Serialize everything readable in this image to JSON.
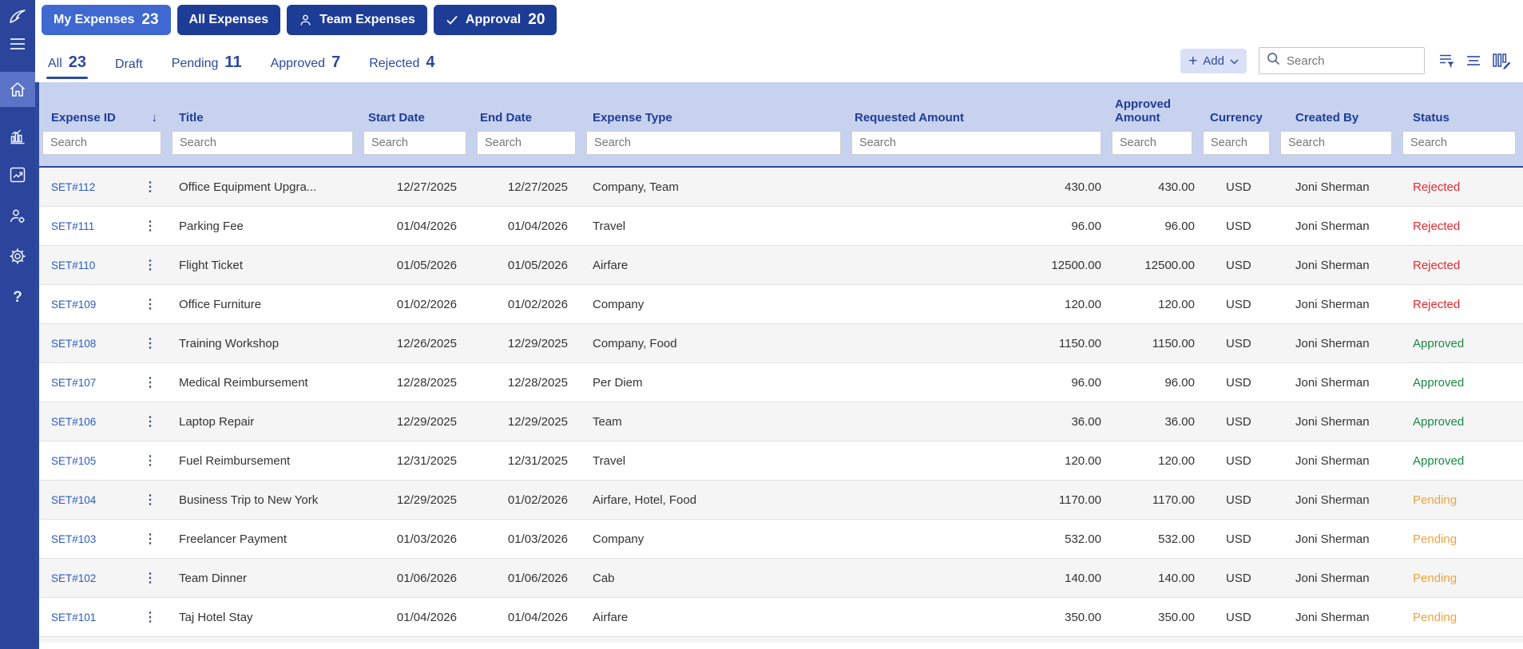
{
  "colors": {
    "sidebar": "#2a459b",
    "sidebar_active": "#5b74c7",
    "tab_active": "#3f69d1",
    "tab_inactive": "#1d3c96",
    "accent": "#2b4a9e",
    "header_bg": "#c7d2ef",
    "link": "#2a5cc0",
    "status": {
      "Rejected": "#e52b2f",
      "Approved": "#188a42",
      "Pending": "#f0a33c"
    }
  },
  "sidebar": {
    "icons": [
      "logo",
      "hamburger-menu",
      "home",
      "bar-chart",
      "trend-line",
      "user-settings",
      "gear",
      "help"
    ],
    "help_glyph": "?"
  },
  "top_tabs": [
    {
      "label": "My Expenses",
      "count": "23",
      "active": true,
      "icon": ""
    },
    {
      "label": "All Expenses",
      "count": "",
      "active": false,
      "icon": ""
    },
    {
      "label": "Team Expenses",
      "count": "",
      "active": false,
      "icon": "person"
    },
    {
      "label": "Approval",
      "count": "20",
      "active": false,
      "icon": "check"
    }
  ],
  "filter_tabs": [
    {
      "label": "All",
      "count": "23",
      "active": true
    },
    {
      "label": "Draft",
      "count": "",
      "active": false
    },
    {
      "label": "Pending",
      "count": "11",
      "active": false
    },
    {
      "label": "Approved",
      "count": "7",
      "active": false
    },
    {
      "label": "Rejected",
      "count": "4",
      "active": false
    }
  ],
  "toolbar": {
    "add_label": "Add",
    "add_plus": "+",
    "search_placeholder": "Search",
    "icons": [
      "filter-list",
      "group-lines",
      "edit-columns"
    ]
  },
  "table": {
    "search_placeholder": "Search",
    "sort_arrow": "↓",
    "row_menu_glyph": "⋮",
    "columns": [
      {
        "label": "Expense ID",
        "sorted": "desc"
      },
      {
        "label": "Title"
      },
      {
        "label": "Start Date"
      },
      {
        "label": "End Date"
      },
      {
        "label": "Expense Type"
      },
      {
        "label": "Requested Amount"
      },
      {
        "label": "Approved Amount"
      },
      {
        "label": "Currency"
      },
      {
        "label": "Created By"
      },
      {
        "label": "Status"
      }
    ],
    "rows": [
      {
        "id": "SET#112",
        "title": "Office Equipment Upgra...",
        "start": "12/27/2025",
        "end": "12/27/2025",
        "type": "Company, Team",
        "requested": "430.00",
        "approved": "430.00",
        "currency": "USD",
        "created_by": "Joni Sherman",
        "status": "Rejected"
      },
      {
        "id": "SET#111",
        "title": "Parking Fee",
        "start": "01/04/2026",
        "end": "01/04/2026",
        "type": "Travel",
        "requested": "96.00",
        "approved": "96.00",
        "currency": "USD",
        "created_by": "Joni Sherman",
        "status": "Rejected"
      },
      {
        "id": "SET#110",
        "title": "Flight Ticket",
        "start": "01/05/2026",
        "end": "01/05/2026",
        "type": "Airfare",
        "requested": "12500.00",
        "approved": "12500.00",
        "currency": "USD",
        "created_by": "Joni Sherman",
        "status": "Rejected"
      },
      {
        "id": "SET#109",
        "title": "Office Furniture",
        "start": "01/02/2026",
        "end": "01/02/2026",
        "type": "Company",
        "requested": "120.00",
        "approved": "120.00",
        "currency": "USD",
        "created_by": "Joni Sherman",
        "status": "Rejected"
      },
      {
        "id": "SET#108",
        "title": "Training Workshop",
        "start": "12/26/2025",
        "end": "12/29/2025",
        "type": "Company, Food",
        "requested": "1150.00",
        "approved": "1150.00",
        "currency": "USD",
        "created_by": "Joni Sherman",
        "status": "Approved"
      },
      {
        "id": "SET#107",
        "title": "Medical Reimbursement",
        "start": "12/28/2025",
        "end": "12/28/2025",
        "type": "Per Diem",
        "requested": "96.00",
        "approved": "96.00",
        "currency": "USD",
        "created_by": "Joni Sherman",
        "status": "Approved"
      },
      {
        "id": "SET#106",
        "title": "Laptop Repair",
        "start": "12/29/2025",
        "end": "12/29/2025",
        "type": "Team",
        "requested": "36.00",
        "approved": "36.00",
        "currency": "USD",
        "created_by": "Joni Sherman",
        "status": "Approved"
      },
      {
        "id": "SET#105",
        "title": "Fuel Reimbursement",
        "start": "12/31/2025",
        "end": "12/31/2025",
        "type": "Travel",
        "requested": "120.00",
        "approved": "120.00",
        "currency": "USD",
        "created_by": "Joni Sherman",
        "status": "Approved"
      },
      {
        "id": "SET#104",
        "title": "Business Trip to New York",
        "start": "12/29/2025",
        "end": "01/02/2026",
        "type": "Airfare, Hotel, Food",
        "requested": "1170.00",
        "approved": "1170.00",
        "currency": "USD",
        "created_by": "Joni Sherman",
        "status": "Pending"
      },
      {
        "id": "SET#103",
        "title": "Freelancer Payment",
        "start": "01/03/2026",
        "end": "01/03/2026",
        "type": "Company",
        "requested": "532.00",
        "approved": "532.00",
        "currency": "USD",
        "created_by": "Joni Sherman",
        "status": "Pending"
      },
      {
        "id": "SET#102",
        "title": "Team Dinner",
        "start": "01/06/2026",
        "end": "01/06/2026",
        "type": "Cab",
        "requested": "140.00",
        "approved": "140.00",
        "currency": "USD",
        "created_by": "Joni Sherman",
        "status": "Pending"
      },
      {
        "id": "SET#101",
        "title": "Taj Hotel Stay",
        "start": "01/04/2026",
        "end": "01/04/2026",
        "type": "Airfare",
        "requested": "350.00",
        "approved": "350.00",
        "currency": "USD",
        "created_by": "Joni Sherman",
        "status": "Pending"
      }
    ]
  }
}
